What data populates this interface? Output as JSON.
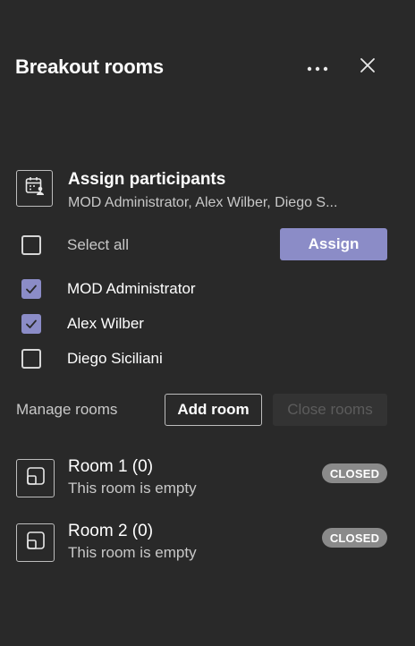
{
  "header": {
    "title": "Breakout rooms",
    "more_icon": "more-options-icon",
    "close_icon": "close-icon"
  },
  "assign": {
    "icon": "calendar-people-icon",
    "title": "Assign participants",
    "subtitle": "MOD Administrator, Alex Wilber, Diego S...",
    "select_all_label": "Select all",
    "select_all_checked": false,
    "assign_button_label": "Assign",
    "participants": [
      {
        "name": "MOD Administrator",
        "checked": true
      },
      {
        "name": "Alex Wilber",
        "checked": true
      },
      {
        "name": "Diego Siciliani",
        "checked": false
      }
    ]
  },
  "manage": {
    "label": "Manage rooms",
    "add_room_label": "Add room",
    "close_rooms_label": "Close rooms"
  },
  "rooms": [
    {
      "name": "Room 1 (0)",
      "status": "This room is empty",
      "badge": "CLOSED",
      "icon": "room-icon"
    },
    {
      "name": "Room 2 (0)",
      "status": "This room is empty",
      "badge": "CLOSED",
      "icon": "room-icon"
    }
  ],
  "colors": {
    "background": "#292929",
    "accent": "#8b8cc7",
    "badge": "#8a8a8a",
    "muted_text": "#c8c8c8",
    "disabled_text": "#5c5c5c"
  }
}
